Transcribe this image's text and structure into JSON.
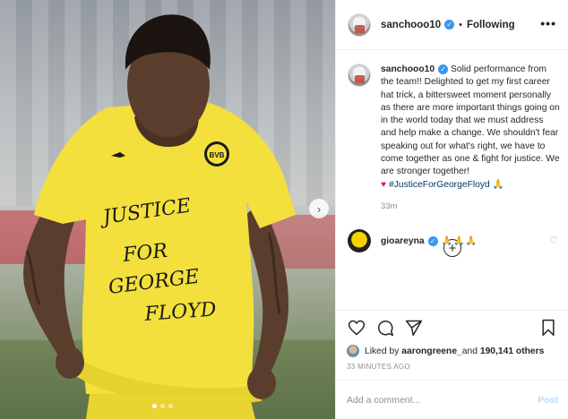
{
  "post": {
    "username": "sanchooo10",
    "following_label": "Following",
    "more_label": "•••",
    "caption": {
      "username": "sanchooo10",
      "text": "Solid performance from the team!! Delighted to get my first career hat trick, a bittersweet moment personally as there are more important things going on in the world today that we must address and help make a change. We shouldn't fear speaking out for what's right, we have to come together as one & fight for justice. We are stronger together!",
      "heart": "♥",
      "hashtag": "#JusticeForGeorgeFloyd",
      "pray": "🙏",
      "time": "33m"
    },
    "load_more_label": "+",
    "comment": {
      "username": "gioareyna",
      "text": "🙏🙏🙏"
    },
    "likes": {
      "prefix": "Liked by ",
      "user": "aarongreene_",
      "middle": " and ",
      "count": "190,141 others"
    },
    "timestamp": "33 MINUTES AGO",
    "add_comment_placeholder": "Add a comment...",
    "post_button": "Post"
  },
  "photo": {
    "shirt_text": [
      "JUSTICE",
      "FOR",
      "GEORGE",
      "FLOYD"
    ],
    "badge": "BVB"
  },
  "colors": {
    "shirt": "#f3e03c",
    "link": "#00376b",
    "verified": "#3897f0",
    "post_disabled": "#b3dbff"
  }
}
